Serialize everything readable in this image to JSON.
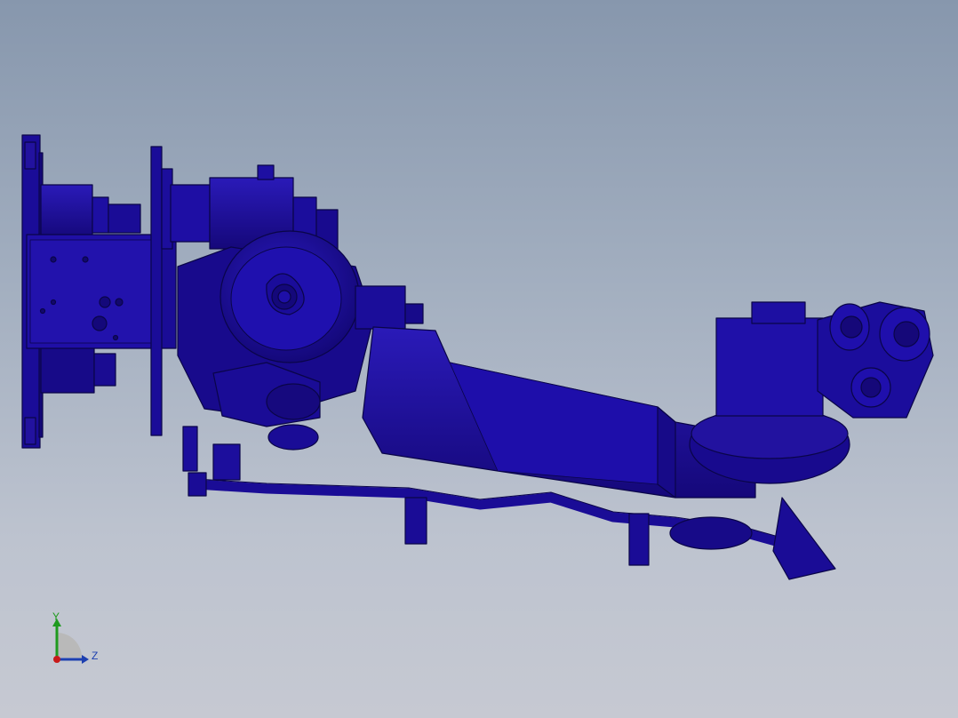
{
  "viewport": {
    "background_top": "#8797ad",
    "background_bottom": "#c6c9d2",
    "model_color": "#1c0f9e",
    "model_shadow": "#10085e",
    "model_highlight": "#2c1cc4"
  },
  "triad": {
    "y_label": "Y",
    "z_label": "Z",
    "y_color": "#1f9a1f",
    "z_color": "#1d3fb0",
    "x_color": "#c81a1a"
  }
}
